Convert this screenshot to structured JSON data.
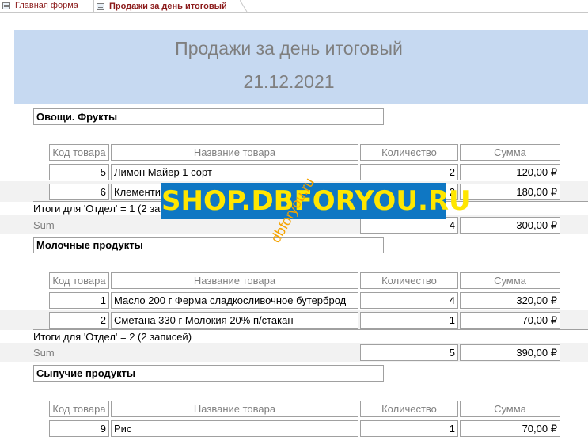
{
  "tabs": [
    {
      "label": "Главная форма",
      "active": false
    },
    {
      "label": "Продажи за день итоговый",
      "active": true
    }
  ],
  "report": {
    "title": "Продажи за день итоговый",
    "date": "21.12.2021"
  },
  "columns": [
    "Код товара",
    "Название товара",
    "Количество",
    "Сумма"
  ],
  "groups": [
    {
      "name": "Овощи. Фрукты",
      "rows": [
        {
          "code": "5",
          "name": "Лимон Майер 1 сорт",
          "qty": "2",
          "sum": "120,00 ₽"
        },
        {
          "code": "6",
          "name": "Клементины",
          "qty": "2",
          "sum": "180,00 ₽"
        }
      ],
      "total_label": "Итоги для 'Отдел' =  1 (2 записей)",
      "sum_label": "Sum",
      "sum_qty": "4",
      "sum_total": "300,00 ₽"
    },
    {
      "name": "Молочные продукты",
      "rows": [
        {
          "code": "1",
          "name": "Масло 200 г Ферма сладкосливочное бутерброд",
          "qty": "4",
          "sum": "320,00 ₽"
        },
        {
          "code": "2",
          "name": "Сметана 330 г Молокия 20% п/стакан",
          "qty": "1",
          "sum": "70,00 ₽"
        }
      ],
      "total_label": "Итоги для 'Отдел' =  2 (2 записей)",
      "sum_label": "Sum",
      "sum_qty": "5",
      "sum_total": "390,00 ₽"
    },
    {
      "name": "Сыпучие продукты",
      "rows": [
        {
          "code": "9",
          "name": "Рис",
          "qty": "1",
          "sum": "70,00 ₽"
        }
      ]
    }
  ],
  "watermark": {
    "main": "SHOP.DBFORYOU.RU",
    "diagonal": "dbforyou.ru"
  },
  "colors": {
    "header_band": "#c6d9f1",
    "alt_row": "#f2f2f2",
    "tab_text": "#8b1a1a",
    "watermark_bg": "#0f77c3",
    "watermark_text": "#ffe600"
  }
}
